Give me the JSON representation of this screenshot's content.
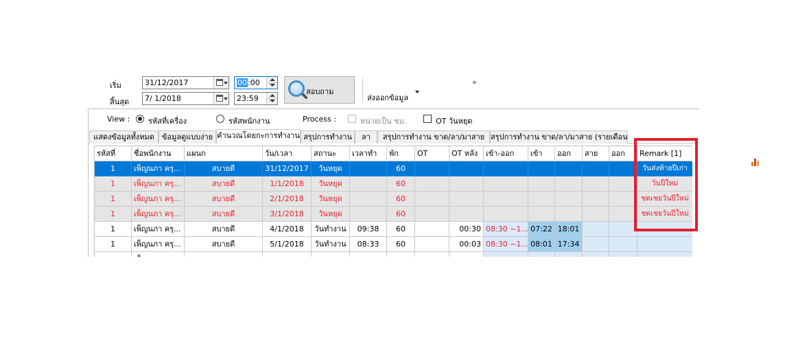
{
  "filter": {
    "start_label": "เริ่ม",
    "end_label": "สิ้นสุด",
    "start_date": "31/12/2017",
    "end_date": "7/  1/2018",
    "start_time_hh": "00",
    "start_time_mm": ":00",
    "end_time": "23:59",
    "search_label": "สอบถาม",
    "export_label": "ส่งออกข้อมูล",
    "more_label": "»"
  },
  "view": {
    "label": "View :",
    "option_machine": "รหัสที่เครื่อง",
    "option_employee": "รหัสพนักงาน",
    "selected": "option_machine",
    "process_label": "Process :",
    "unit_hours_label": "หน่วยเป็น ชม.",
    "ot_holiday_label": "OT วันหยุด"
  },
  "tabs": [
    "แสดงข้อมูลทั้งหมด",
    "ข้อมูลดูแบบง่าย",
    "คำนวณโดยกะการทำงาน",
    "สรุปการทำงาน",
    "ลา",
    "สรุปการทำงาน ขาด/ลา/มาสาย",
    "สรุปการทำงาน ขาด/ลา/มาสาย (รายเดือน)"
  ],
  "active_tab": 2,
  "table": {
    "columns": [
      "รหัสที่",
      "ชื่อพนักงาน",
      "แผนก",
      "วัน/เวลา",
      "สถานะ",
      "เวลาทำ",
      "พัก",
      "OT",
      "OT หลัง",
      "เข้า-ออก",
      "เข้า",
      "ออก",
      "สาย",
      "ออก",
      "Remark [1]"
    ],
    "rows": [
      [
        "1",
        "เพ็ญนภา ครุ...",
        "สบายดี",
        "31/12/2017",
        "วันหยุด",
        "",
        "60",
        "",
        "",
        "",
        "",
        "",
        "",
        "",
        "วันส่งท้ายปีเก่า"
      ],
      [
        "1",
        "เพ็ญนภา ครุ...",
        "สบายดี",
        "1/1/2018",
        "วันหยุด",
        "",
        "60",
        "",
        "",
        "",
        "",
        "",
        "",
        "",
        "วันปีใหม่"
      ],
      [
        "1",
        "เพ็ญนภา ครุ...",
        "สบายดี",
        "2/1/2018",
        "วันหยุด",
        "",
        "60",
        "",
        "",
        "",
        "",
        "",
        "",
        "",
        "ชดเชยวันปีใหม่"
      ],
      [
        "1",
        "เพ็ญนภา ครุ...",
        "สบายดี",
        "3/1/2018",
        "วันหยุด",
        "",
        "60",
        "",
        "",
        "",
        "",
        "",
        "",
        "",
        "ชดเชยวันปีใหม่"
      ],
      [
        "1",
        "เพ็ญนภา ครุ...",
        "สบายดี",
        "4/1/2018",
        "วันทำงาน",
        "09:38",
        "60",
        "",
        "00:30",
        "08:30 ~1...",
        "07:22",
        "18:01",
        "",
        "",
        ""
      ],
      [
        "1",
        "เพ็ญนภา ครุ...",
        "สบายดี",
        "5/1/2018",
        "วันทำงาน",
        "08:33",
        "60",
        "",
        "00:03",
        "08:30 ~1...",
        "08:01",
        "17:34",
        "",
        "",
        ""
      ],
      [
        "",
        "เพ็",
        "",
        "",
        "",
        "",
        "",
        "",
        "",
        "",
        "",
        "",
        "",
        "",
        ""
      ]
    ]
  },
  "colors": {
    "selected_row_bg": "#0078d7",
    "holiday_text": "#e8222e",
    "holiday_bg": "#e5e5e5",
    "shift_cell_bg": "#dbeaf9",
    "time_cell_bg": "#9fcfee",
    "highlight_box": "#e0202c"
  }
}
